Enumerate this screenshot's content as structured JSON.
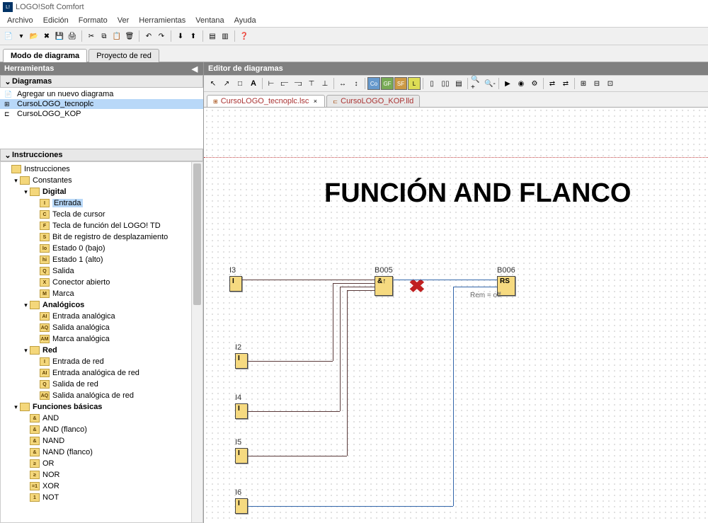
{
  "app": {
    "title": "LOGO!Soft Comfort",
    "icon_label": "L!"
  },
  "menu": {
    "items": [
      "Archivo",
      "Edición",
      "Formato",
      "Ver",
      "Herramientas",
      "Ventana",
      "Ayuda"
    ]
  },
  "modetabs": {
    "active": "Modo de diagrama",
    "inactive": "Proyecto de red"
  },
  "left": {
    "header": "Herramientas",
    "diagrams_title": "Diagramas",
    "add_new": "Agregar un nuevo diagrama",
    "diag_selected": "CursoLOGO_tecnoplc",
    "diag_other": "CursoLOGO_KOP",
    "instr_title": "Instrucciones",
    "tree": {
      "root": "Instrucciones",
      "constantes": "Constantes",
      "digital": "Digital",
      "entrada": "Entrada",
      "tecla_cursor": "Tecla de cursor",
      "tecla_funcion": "Tecla de función del LOGO! TD",
      "bit_registro": "Bit de registro de desplazamiento",
      "estado0": "Estado 0 (bajo)",
      "estado1": "Estado 1 (alto)",
      "salida": "Salida",
      "conector": "Conector abierto",
      "marca": "Marca",
      "analogicos": "Analógicos",
      "ent_analog": "Entrada analógica",
      "sal_analog": "Salida analógica",
      "marca_analog": "Marca analógica",
      "red": "Red",
      "ent_red": "Entrada de red",
      "ent_analog_red": "Entrada analógica de red",
      "sal_red": "Salida de red",
      "sal_analog_red": "Salida analógica de red",
      "func_basicas": "Funciones básicas",
      "and": "AND",
      "and_flanco": "AND (flanco)",
      "nand": "NAND",
      "nand_flanco": "NAND (flanco)",
      "or": "OR",
      "nor": "NOR",
      "xor": "XOR",
      "not": "NOT"
    }
  },
  "editor": {
    "header": "Editor de diagramas",
    "tab_active": "CursoLOGO_tecnoplc.lsc",
    "tab_inactive": "CursoLOGO_KOP.lld",
    "tb_labels": {
      "co": "Co",
      "gf": "GF",
      "sf": "SF",
      "l": "L"
    }
  },
  "canvas": {
    "title": "FUNCIÓN AND FLANCO",
    "i3": "I3",
    "i2": "I2",
    "i4": "I4",
    "i5": "I5",
    "i6": "I6",
    "i_glyph": "I",
    "b005": "B005",
    "b005_sym": "&↑",
    "b006": "B006",
    "b006_sym": "RS",
    "rem": "Rem = off"
  }
}
